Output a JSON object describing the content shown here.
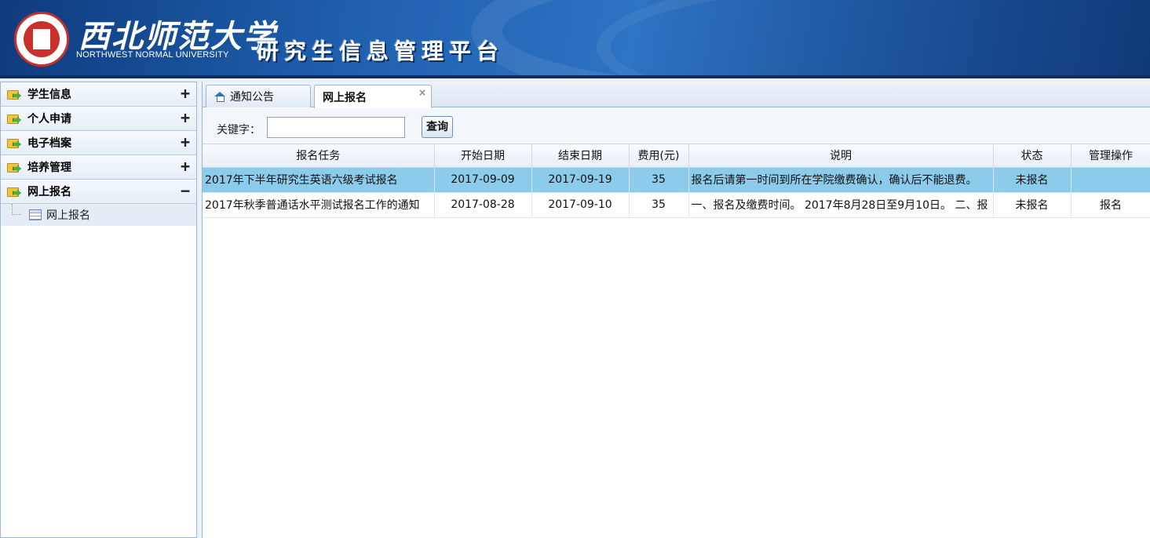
{
  "header": {
    "university_cn": "西北师范大学",
    "university_en": "NORTHWEST NORMAL UNIVERSITY",
    "platform_title": "研究生信息管理平台"
  },
  "sidebar": {
    "sections": [
      {
        "label": "学生信息",
        "toggle": "+"
      },
      {
        "label": "个人申请",
        "toggle": "+"
      },
      {
        "label": "电子档案",
        "toggle": "+"
      },
      {
        "label": "培养管理",
        "toggle": "+"
      },
      {
        "label": "网上报名",
        "toggle": "−",
        "items": [
          {
            "label": "网上报名"
          }
        ]
      }
    ]
  },
  "tabs": [
    {
      "label": "通知公告"
    },
    {
      "label": "网上报名",
      "close": "×"
    }
  ],
  "toolbar": {
    "keyword_label": "关键字：",
    "keyword_value": "",
    "search_label": "查询"
  },
  "table": {
    "columns": [
      "报名任务",
      "开始日期",
      "结束日期",
      "费用(元)",
      "说明",
      "状态",
      "管理操作"
    ],
    "rows": [
      {
        "task": "2017年下半年研究生英语六级考试报名",
        "start": "2017-09-09",
        "end": "2017-09-19",
        "fee": "35",
        "desc": "报名后请第一时间到所在学院缴费确认，确认后不能退费。",
        "status": "未报名",
        "action": ""
      },
      {
        "task": "2017年秋季普通话水平测试报名工作的通知",
        "start": "2017-08-28",
        "end": "2017-09-10",
        "fee": "35",
        "desc": "一、报名及缴费时间。 2017年8月28日至9月10日。 二、报",
        "status": "未报名",
        "action": "报名"
      }
    ]
  },
  "colors": {
    "header_blue": "#1f5fae",
    "selected_row": "#8ccbea",
    "sidebar_sub_bg": "#e4ecf6"
  }
}
